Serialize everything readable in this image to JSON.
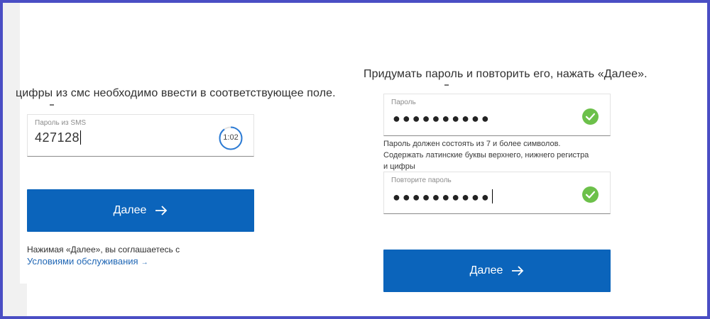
{
  "sms_step": {
    "instruction": "цифры из смс необходимо ввести в соответствующее поле.",
    "sms_field": {
      "label": "Пароль из SMS",
      "value": "427128"
    },
    "timer": "1:02",
    "timer_progress": 0.9,
    "next_button": "Далее",
    "agreement_text": "Нажимая «Далее», вы соглашаетесь с",
    "terms_link": "Условиями обслуживания",
    "terms_link_arrow": "→"
  },
  "password_step": {
    "instruction": "Придумать пароль и повторить его, нажать «Далее».",
    "password_field": {
      "label": "Пароль",
      "value": "●●●●●●●●●●",
      "status_icon": "check-icon"
    },
    "hint_lines": [
      "Пароль должен состоять из 7 и более символов.",
      "Содержать латинские буквы верхнего, нижнего регистра",
      "и цифры"
    ],
    "repeat_field": {
      "label": "Повторите пароль",
      "value": "●●●●●●●●●●",
      "status_icon": "check-icon"
    },
    "next_button": "Далее"
  },
  "colors": {
    "frame": "#4a4ec4",
    "button": "#0b64bb",
    "link": "#2067b5",
    "check": "#6cc04a"
  }
}
